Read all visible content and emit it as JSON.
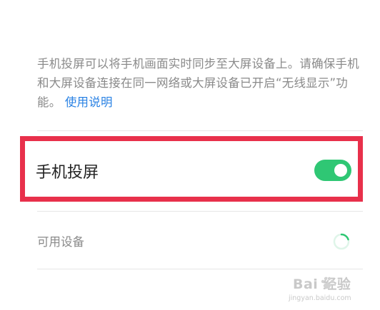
{
  "description": {
    "text": "手机投屏可以将手机画面实时同步至大屏设备上。请确保手机和大屏设备连接在同一网络或大屏设备已开启“无线显示”功能。",
    "link_label": "使用说明"
  },
  "screen_cast": {
    "label": "手机投屏",
    "enabled": true
  },
  "devices": {
    "label": "可用设备",
    "status": "searching"
  },
  "watermark": {
    "main_text": "Bai 经验",
    "sub_text": "jingyan.baidu.com"
  },
  "colors": {
    "accent": "#2fc774",
    "link": "#2a82e4",
    "highlight": "#e8304b",
    "secondary_text": "#8a8a8a",
    "primary_text": "#222222"
  },
  "icons": {
    "toggle": "toggle-switch-on",
    "loading": "loading-spinner-icon",
    "watermark_logo": "baidu-paw-icon"
  }
}
